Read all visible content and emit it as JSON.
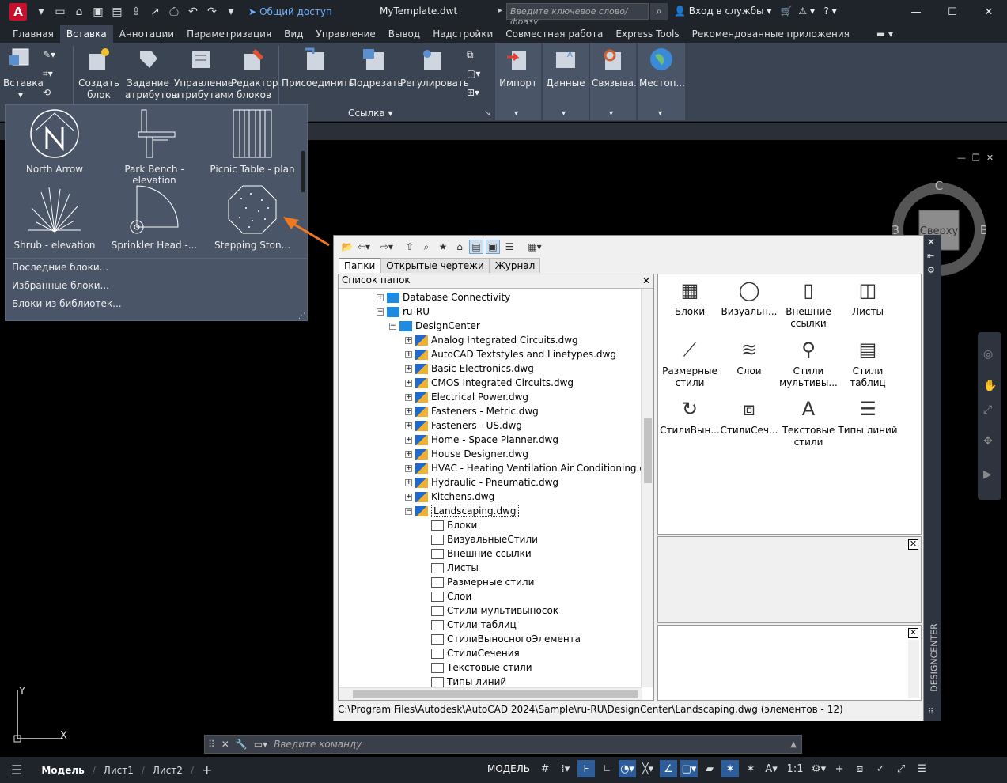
{
  "titlebar": {
    "logo": "A",
    "share_label": "Общий доступ",
    "doc_title": "MyTemplate.dwt",
    "search_placeholder": "Введите ключевое слово/фразу",
    "signin_label": "Вход в службы"
  },
  "tabs": [
    "Главная",
    "Вставка",
    "Аннотации",
    "Параметризация",
    "Вид",
    "Управление",
    "Вывод",
    "Надстройки",
    "Совместная работа",
    "Express Tools",
    "Рекомендованные приложения"
  ],
  "active_tab": "Вставка",
  "ribbon": {
    "insert_label": "Вставка",
    "create_block": [
      "Создать",
      "блок"
    ],
    "define_attrs": [
      "Задание",
      "атрибутов"
    ],
    "manage_attrs": [
      "Управление",
      "атрибутами"
    ],
    "block_editor": [
      "Редактор",
      "блоков"
    ],
    "attach": "Присоединить",
    "clip": "Подрезать",
    "adjust": "Регулировать",
    "reference_panel": "Ссылка",
    "import": "Импорт",
    "data": "Данные",
    "linking": "Связыва...",
    "location": "Местоп..."
  },
  "gallery": {
    "items": [
      "North Arrow",
      "Park Bench - elevation",
      "Picnic Table - plan",
      "Shrub - elevation",
      "Sprinkler Head -...",
      "Stepping Ston..."
    ],
    "links": [
      "Последние блоки...",
      "Избранные блоки...",
      "Блоки из библиотек..."
    ]
  },
  "designcenter": {
    "tabs": [
      "Папки",
      "Открытые чертежи",
      "Журнал"
    ],
    "tree_header": "Список папок",
    "tree": [
      {
        "label": "Database Connectivity",
        "indent": 0,
        "exp": "+",
        "icon": "folder"
      },
      {
        "label": "ru-RU",
        "indent": 0,
        "exp": "-",
        "icon": "folder"
      },
      {
        "label": "DesignCenter",
        "indent": 1,
        "exp": "-",
        "icon": "folder"
      },
      {
        "label": "Analog Integrated Circuits.dwg",
        "indent": 2,
        "exp": "+",
        "icon": "dwg"
      },
      {
        "label": "AutoCAD Textstyles and Linetypes.dwg",
        "indent": 2,
        "exp": "+",
        "icon": "dwg"
      },
      {
        "label": "Basic Electronics.dwg",
        "indent": 2,
        "exp": "+",
        "icon": "dwg"
      },
      {
        "label": "CMOS Integrated Circuits.dwg",
        "indent": 2,
        "exp": "+",
        "icon": "dwg"
      },
      {
        "label": "Electrical Power.dwg",
        "indent": 2,
        "exp": "+",
        "icon": "dwg"
      },
      {
        "label": "Fasteners - Metric.dwg",
        "indent": 2,
        "exp": "+",
        "icon": "dwg"
      },
      {
        "label": "Fasteners - US.dwg",
        "indent": 2,
        "exp": "+",
        "icon": "dwg"
      },
      {
        "label": "Home - Space Planner.dwg",
        "indent": 2,
        "exp": "+",
        "icon": "dwg"
      },
      {
        "label": "House Designer.dwg",
        "indent": 2,
        "exp": "+",
        "icon": "dwg"
      },
      {
        "label": "HVAC - Heating Ventilation Air Conditioning.dwg",
        "indent": 2,
        "exp": "+",
        "icon": "dwg"
      },
      {
        "label": "Hydraulic - Pneumatic.dwg",
        "indent": 2,
        "exp": "+",
        "icon": "dwg"
      },
      {
        "label": "Kitchens.dwg",
        "indent": 2,
        "exp": "+",
        "icon": "dwg"
      },
      {
        "label": "Landscaping.dwg",
        "indent": 2,
        "exp": "-",
        "icon": "dwg",
        "selected": true
      },
      {
        "label": "Блоки",
        "indent": 3,
        "exp": "",
        "icon": "sub"
      },
      {
        "label": "ВизуальныеСтили",
        "indent": 3,
        "exp": "",
        "icon": "sub"
      },
      {
        "label": "Внешние ссылки",
        "indent": 3,
        "exp": "",
        "icon": "sub"
      },
      {
        "label": "Листы",
        "indent": 3,
        "exp": "",
        "icon": "sub"
      },
      {
        "label": "Размерные стили",
        "indent": 3,
        "exp": "",
        "icon": "sub"
      },
      {
        "label": "Слои",
        "indent": 3,
        "exp": "",
        "icon": "sub"
      },
      {
        "label": "Стили мультивыносок",
        "indent": 3,
        "exp": "",
        "icon": "sub"
      },
      {
        "label": "Стили таблиц",
        "indent": 3,
        "exp": "",
        "icon": "sub"
      },
      {
        "label": "СтилиВыносногоЭлемента",
        "indent": 3,
        "exp": "",
        "icon": "sub"
      },
      {
        "label": "СтилиСечения",
        "indent": 3,
        "exp": "",
        "icon": "sub"
      },
      {
        "label": "Текстовые стили",
        "indent": 3,
        "exp": "",
        "icon": "sub"
      },
      {
        "label": "Типы линий",
        "indent": 3,
        "exp": "",
        "icon": "sub"
      }
    ],
    "content_items": [
      [
        "Блоки"
      ],
      [
        "Визуальн..."
      ],
      [
        "Внешние",
        "ссылки"
      ],
      [
        "Листы"
      ],
      [
        "Размерные",
        "стили"
      ],
      [
        "Слои"
      ],
      [
        "Стили",
        "мультивы..."
      ],
      [
        "Стили",
        "таблиц"
      ],
      [
        "СтилиВын..."
      ],
      [
        "СтилиСеч..."
      ],
      [
        "Текстовые",
        "стили"
      ],
      [
        "Типы линий"
      ]
    ],
    "status_path": "C:\\Program Files\\Autodesk\\AutoCAD 2024\\Sample\\ru-RU\\DesignCenter\\Landscaping.dwg (элементов  - 12)",
    "vertical_title": "DESIGNCENTER"
  },
  "viewcube": {
    "top": "Сверху",
    "n": "С",
    "e": "В",
    "w": "З"
  },
  "command_placeholder": "Введите команду",
  "statusbar": {
    "model_tab": "Модель",
    "layout1": "Лист1",
    "layout2": "Лист2",
    "model_btn": "МОДЕЛЬ",
    "scale": "1:1"
  }
}
